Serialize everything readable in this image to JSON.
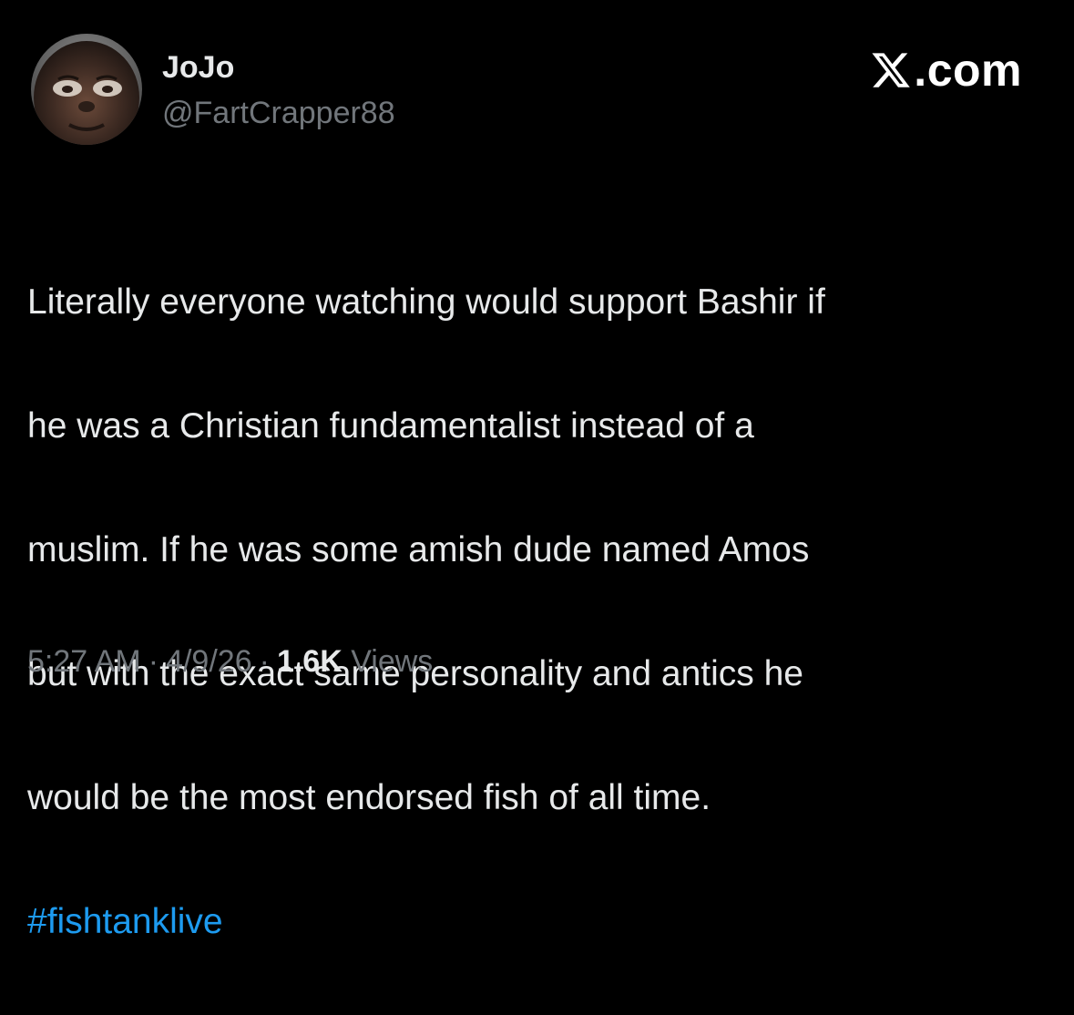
{
  "colors": {
    "background": "#000000",
    "primary_text": "#e7e9ea",
    "secondary_text": "#71767b",
    "link": "#1d9bf0"
  },
  "author": {
    "name": "JoJo",
    "handle": "@FartCrapper88",
    "avatar_icon": "profile-photo"
  },
  "brand": {
    "logo_icon": "x-logo-icon",
    "text": ".com"
  },
  "tweet": {
    "text_lines": [
      "Literally everyone watching would support Bashir if",
      "he was a Christian fundamentalist instead of a",
      "muslim. If he was some amish dude named Amos",
      "but with the exact same personality and antics he",
      "would be the most endorsed fish of all time."
    ],
    "hashtag": "#fishtanklive"
  },
  "meta": {
    "time": "5:27 AM",
    "separator": "·",
    "date": "4/9/26",
    "views_count": "1.6K",
    "views_label": "Views"
  }
}
